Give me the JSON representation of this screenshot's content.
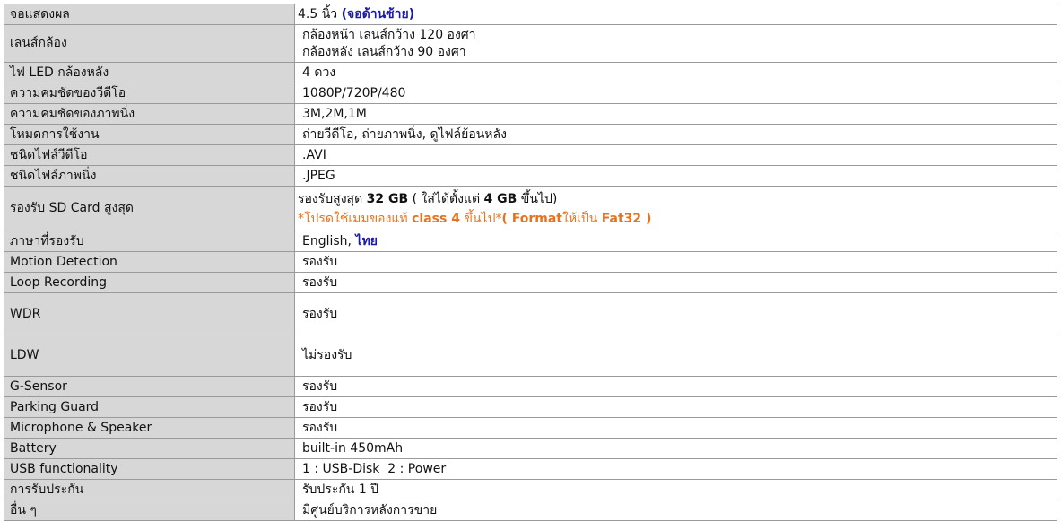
{
  "rows": [
    {
      "label": "จอแสดงผล",
      "value": "4.5 นิ้ว ",
      "value_extra": "(จอด้านซ้าย)"
    },
    {
      "label": "เลนส์กล้อง",
      "value_line1": "กล้องหน้า เลนส์กว้าง 120 องศา",
      "value_line2": "กล้องหลัง เลนส์กว้าง 90 องศา"
    },
    {
      "label": "ไฟ LED กล้องหลัง",
      "value": "4 ดวง"
    },
    {
      "label": "ความคมชัดของวีดีโอ",
      "value": "1080P/720P/480"
    },
    {
      "label": "ความคมชัดของภาพนิ่ง",
      "value": "3M,2M,1M"
    },
    {
      "label": "โหมดการใช้งาน",
      "value": "ถ่ายวีดีโอ, ถ่ายภาพนิ่ง, ดูไฟล์ย้อนหลัง"
    },
    {
      "label": "ชนิดไฟล์วีดีโอ",
      "value": ".AVI"
    },
    {
      "label": "ชนิดไฟล์ภาพนิ่ง",
      "value": ".JPEG"
    },
    {
      "label": "รองรับ SD Card สูงสุด",
      "line1": {
        "a": "รองรับสูงสุด ",
        "b": "32 GB",
        "c": " ( ใส่ได้ตั้งแต่ ",
        "d": "4 GB",
        "e": " ขึ้นไป)"
      },
      "line2": {
        "a": "*โปรดใช้เมมของแท้ ",
        "b": "class 4",
        "c": " ขึ้นไป*",
        "d": "( Format",
        "e": "ให้เป็น ",
        "f": "Fat32 )"
      }
    },
    {
      "label": "ภาษาที่รองรับ",
      "value": "English, ",
      "value_extra": "ไทย"
    },
    {
      "label": "Motion Detection",
      "value": "รองรับ"
    },
    {
      "label": "Loop Recording",
      "value": "รองรับ"
    },
    {
      "label": "WDR",
      "value": "รองรับ"
    },
    {
      "label": "LDW",
      "value": "ไม่รองรับ"
    },
    {
      "label": "G-Sensor",
      "value": "รองรับ"
    },
    {
      "label": "Parking Guard",
      "value": "รองรับ"
    },
    {
      "label": "Microphone & Speaker",
      "value": "รองรับ"
    },
    {
      "label": "Battery",
      "value": "built-in 450mAh"
    },
    {
      "label": "USB functionality",
      "value": "1 : USB-Disk  2 : Power"
    },
    {
      "label": "การรับประกัน",
      "value": "รับประกัน 1 ปี"
    },
    {
      "label": "อื่น ๆ",
      "value": "มีศูนย์บริการหลังการขาย"
    }
  ],
  "colors": {
    "label_bg": "#d7d7d7",
    "border": "#9a9a9a",
    "blue": "#1a1aa6",
    "orange": "#e8731e"
  }
}
